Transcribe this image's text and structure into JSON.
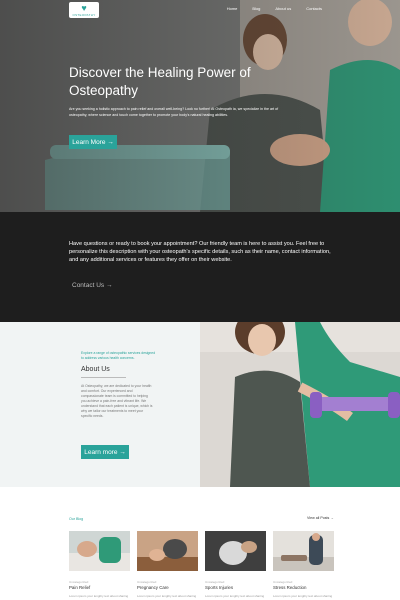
{
  "colors": {
    "accent": "#2aa39a",
    "dark_band": "#1e1e1e",
    "about_bg": "#f1f4f4"
  },
  "header": {
    "logo_icon": "heart-icon",
    "logo_text": "OSTEOPATHY",
    "nav": [
      "Home",
      "Blog",
      "About us",
      "Contacts"
    ]
  },
  "hero": {
    "title": "Discover the Healing Power of Osteopathy",
    "text": "Are you seeking a holistic approach to pain relief and overall well-being? Look no further! At Osteopath ia, we specialize in the art of osteopathy, where science and touch come together to promote your body's natural healing abilities.",
    "button": "Learn More →"
  },
  "contact": {
    "text": "Have questions or ready to book your appointment? Our friendly team is here to assist you. Feel free to personalize this description with your osteopath's specific details, such as their name, contact information, and any additional services or features they offer on their website.",
    "link": "Contact Us →"
  },
  "about": {
    "kicker": "Explore a range of osteopathic services designed to address various health concerns.",
    "heading": "About Us",
    "text": "At Osteopathy, we are dedicated to your health and comfort. Our experienced and compassionate team is committed to helping you achieve a pain-free and vibrant life. We understand that each patient is unique, which is why we tailor our treatments to meet your specific needs.",
    "button": "Learn more →"
  },
  "blog": {
    "label": "Our Blog",
    "view_all": "View all Posts →",
    "cards": [
      {
        "category": "Uncategorized",
        "title": "Pain Relief",
        "excerpt": "Lorem ipsum your lengthy text about sharing"
      },
      {
        "category": "Uncategorized",
        "title": "Pregnancy Care",
        "excerpt": "Lorem ipsum your lengthy text about sharing"
      },
      {
        "category": "Uncategorized",
        "title": "Sports Injuries",
        "excerpt": "Lorem ipsum your lengthy text about sharing"
      },
      {
        "category": "Uncategorized",
        "title": "Stress Reduction",
        "excerpt": "Lorem ipsum your lengthy text about sharing"
      }
    ]
  }
}
